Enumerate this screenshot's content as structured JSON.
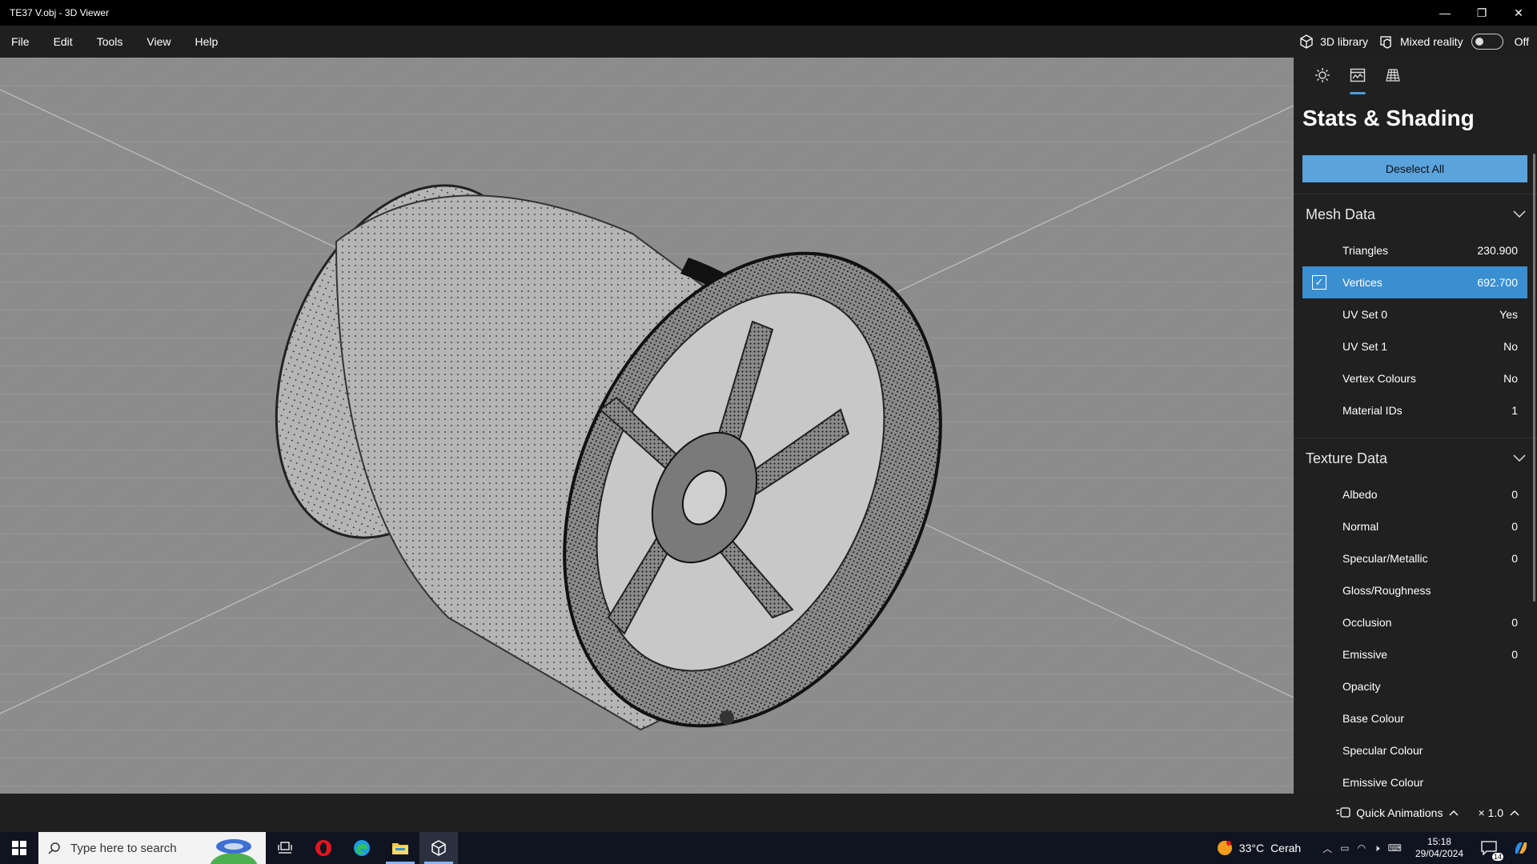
{
  "window": {
    "title": "TE37 V.obj - 3D Viewer",
    "minimize": "—",
    "restore": "❐",
    "close": "✕"
  },
  "menu": [
    "File",
    "Edit",
    "Tools",
    "View",
    "Help"
  ],
  "menubar_right": {
    "library_label": "3D library",
    "mixed_reality_label": "Mixed reality",
    "toggle_state": "Off"
  },
  "panel": {
    "tabs": [
      "sun-icon",
      "stats-icon",
      "grid-icon"
    ],
    "title": "Stats & Shading",
    "deselect_label": "Deselect All",
    "mesh_section": {
      "title": "Mesh Data",
      "rows": [
        {
          "label": "Triangles",
          "value": "230.900",
          "selected": false
        },
        {
          "label": "Vertices",
          "value": "692.700",
          "selected": true
        },
        {
          "label": "UV Set 0",
          "value": "Yes",
          "selected": false
        },
        {
          "label": "UV Set 1",
          "value": "No",
          "selected": false
        },
        {
          "label": "Vertex Colours",
          "value": "No",
          "selected": false
        },
        {
          "label": "Material IDs",
          "value": "1",
          "selected": false
        }
      ]
    },
    "texture_section": {
      "title": "Texture Data",
      "rows": [
        {
          "label": "Albedo",
          "value": "0"
        },
        {
          "label": "Normal",
          "value": "0"
        },
        {
          "label": "Specular/Metallic",
          "value": "0"
        },
        {
          "label": "Gloss/Roughness",
          "value": ""
        },
        {
          "label": "Occlusion",
          "value": "0"
        },
        {
          "label": "Emissive",
          "value": "0"
        },
        {
          "label": "Opacity",
          "value": ""
        },
        {
          "label": "Base Colour",
          "value": ""
        },
        {
          "label": "Specular Colour",
          "value": ""
        },
        {
          "label": "Emissive Colour",
          "value": ""
        }
      ]
    }
  },
  "statusbar": {
    "quick_animations": "Quick Animations",
    "speed": "× 1.0"
  },
  "taskbar": {
    "search_placeholder": "Type here to search",
    "weather_temp": "33°C",
    "weather_desc": "Cerah",
    "time": "15:18",
    "date": "29/04/2024",
    "notification_count": "14"
  },
  "colors": {
    "accent": "#5ba3dc",
    "selected_row": "#3a8fd0",
    "viewport_bg": "#8c8c8c",
    "panel_bg": "#202020"
  }
}
